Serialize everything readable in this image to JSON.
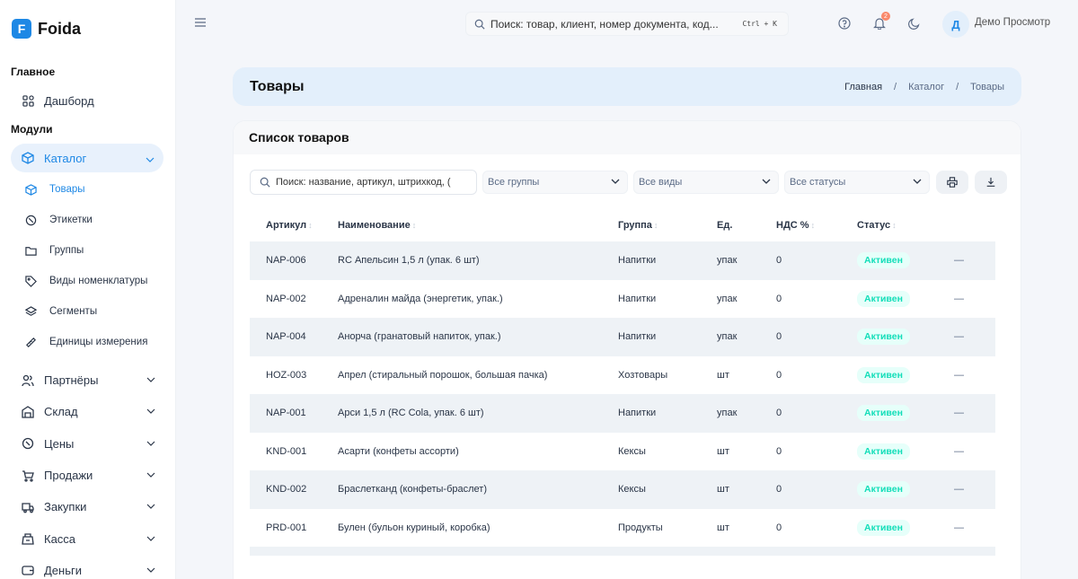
{
  "brand": {
    "logo_letter": "F",
    "name": "Foida"
  },
  "topbar": {
    "search_placeholder": "Поиск: товар, клиент, номер документа, код...",
    "shortcut": "Ctrl + K",
    "notification_count": "2",
    "avatar_letter": "Д",
    "username": "Демо Просмотр"
  },
  "sidebar": {
    "main_title": "Главное",
    "dashboard": "Дашборд",
    "modules_title": "Модули",
    "catalog": "Каталог",
    "catalog_items": [
      {
        "label": "Товары",
        "icon": "box-icon"
      },
      {
        "label": "Этикетки",
        "icon": "tag-icon"
      },
      {
        "label": "Группы",
        "icon": "folder-icon"
      },
      {
        "label": "Виды номенклатуры",
        "icon": "tag-outline-icon"
      },
      {
        "label": "Сегменты",
        "icon": "layers-icon"
      },
      {
        "label": "Единицы измерения",
        "icon": "ruler-icon"
      }
    ],
    "modules": [
      {
        "label": "Партнёры",
        "icon": "users-icon"
      },
      {
        "label": "Склад",
        "icon": "warehouse-icon"
      },
      {
        "label": "Цены",
        "icon": "price-tag-icon"
      },
      {
        "label": "Продажи",
        "icon": "cart-icon"
      },
      {
        "label": "Закупки",
        "icon": "truck-icon"
      },
      {
        "label": "Касса",
        "icon": "cash-register-icon"
      },
      {
        "label": "Деньги",
        "icon": "wallet-icon"
      }
    ]
  },
  "page": {
    "title": "Товары",
    "breadcrumb": [
      "Главная",
      "/",
      "Каталог",
      "/",
      "Товары"
    ]
  },
  "card": {
    "title": "Список товаров",
    "search_placeholder": "Поиск: название, артикул, штрихкод, (",
    "filter_groups": "Все группы",
    "filter_types": "Все виды",
    "filter_statuses": "Все статусы"
  },
  "table": {
    "columns": {
      "sku": "Артикул",
      "name": "Наименование",
      "group": "Группа",
      "unit": "Ед.",
      "vat": "НДС %",
      "status": "Статус"
    },
    "rows": [
      {
        "sku": "NAP-006",
        "name": "RC Апельсин 1,5 л (упак. 6 шт)",
        "group": "Напитки",
        "unit": "упак",
        "vat": "0",
        "status": "Активен",
        "action": "—"
      },
      {
        "sku": "NAP-002",
        "name": "Адреналин майда (энергетик, упак.)",
        "group": "Напитки",
        "unit": "упак",
        "vat": "0",
        "status": "Активен",
        "action": "—"
      },
      {
        "sku": "NAP-004",
        "name": "Анорча (гранатовый напиток, упак.)",
        "group": "Напитки",
        "unit": "упак",
        "vat": "0",
        "status": "Активен",
        "action": "—"
      },
      {
        "sku": "HOZ-003",
        "name": "Апрел (стиральный порошок, большая пачка)",
        "group": "Хозтовары",
        "unit": "шт",
        "vat": "0",
        "status": "Активен",
        "action": "—"
      },
      {
        "sku": "NAP-001",
        "name": "Арси 1,5 л (RC Cola, упак. 6 шт)",
        "group": "Напитки",
        "unit": "упак",
        "vat": "0",
        "status": "Активен",
        "action": "—"
      },
      {
        "sku": "KND-001",
        "name": "Асарти (конфеты ассорти)",
        "group": "Кексы",
        "unit": "шт",
        "vat": "0",
        "status": "Активен",
        "action": "—"
      },
      {
        "sku": "KND-002",
        "name": "Браслетканд (конфеты-браслет)",
        "group": "Кексы",
        "unit": "шт",
        "vat": "0",
        "status": "Активен",
        "action": "—"
      },
      {
        "sku": "PRD-001",
        "name": "Булен (бульон куриный, коробка)",
        "group": "Продукты",
        "unit": "шт",
        "vat": "0",
        "status": "Активен",
        "action": "—"
      }
    ]
  },
  "colors": {
    "accent": "#1e88e5",
    "header_bg": "#e3effb",
    "status_green": "#13deb9",
    "stripe": "#eef2f6"
  }
}
